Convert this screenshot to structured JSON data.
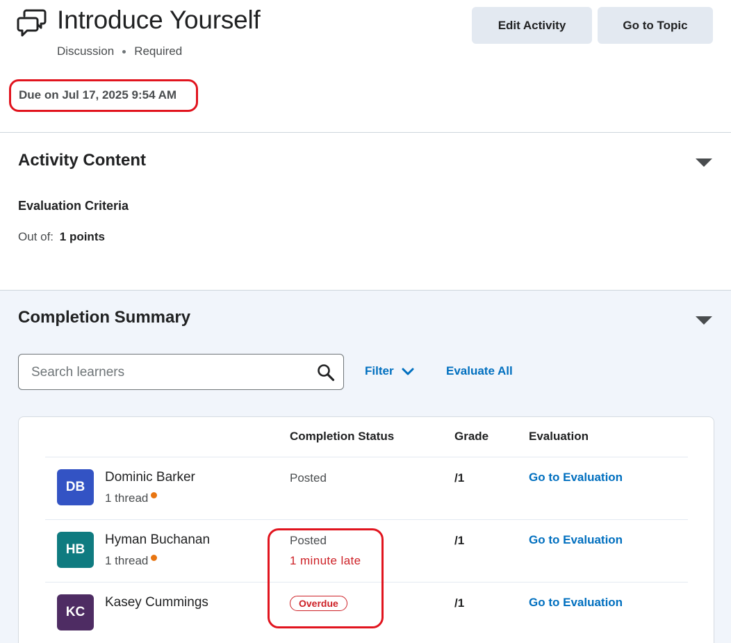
{
  "header": {
    "title": "Introduce Yourself",
    "type": "Discussion",
    "requirement": "Required",
    "due": "Due on Jul 17, 2025 9:54 AM",
    "buttons": {
      "edit": "Edit Activity",
      "go_to_topic": "Go to Topic"
    }
  },
  "activity_content": {
    "title": "Activity Content",
    "evaluation_criteria": "Evaluation Criteria",
    "out_of_label": "Out of:",
    "out_of_value": "1 points"
  },
  "completion_summary": {
    "title": "Completion Summary",
    "search_placeholder": "Search learners",
    "filter_label": "Filter",
    "evaluate_all_label": "Evaluate All",
    "columns": {
      "completion_status": "Completion Status",
      "grade": "Grade",
      "evaluation": "Evaluation"
    },
    "learners": [
      {
        "initials": "DB",
        "name": "Dominic Barker",
        "threads": "1 thread",
        "avatar_color": "#3353c4",
        "status": "Posted",
        "late": "",
        "overdue": "",
        "grade": "/1",
        "evaluation_link": "Go to Evaluation"
      },
      {
        "initials": "HB",
        "name": "Hyman Buchanan",
        "threads": "1 thread",
        "avatar_color": "#0f7b80",
        "status": "Posted",
        "late": "1 minute late",
        "overdue": "",
        "grade": "/1",
        "evaluation_link": "Go to Evaluation"
      },
      {
        "initials": "KC",
        "name": "Kasey Cummings",
        "threads": "",
        "avatar_color": "#4e2c63",
        "status": "",
        "late": "",
        "overdue": "Overdue",
        "grade": "/1",
        "evaluation_link": "Go to Evaluation"
      }
    ]
  },
  "colors": {
    "link": "#006fbf",
    "highlight": "#e1141e",
    "late": "#cd2026",
    "new_dot": "#e87511"
  }
}
